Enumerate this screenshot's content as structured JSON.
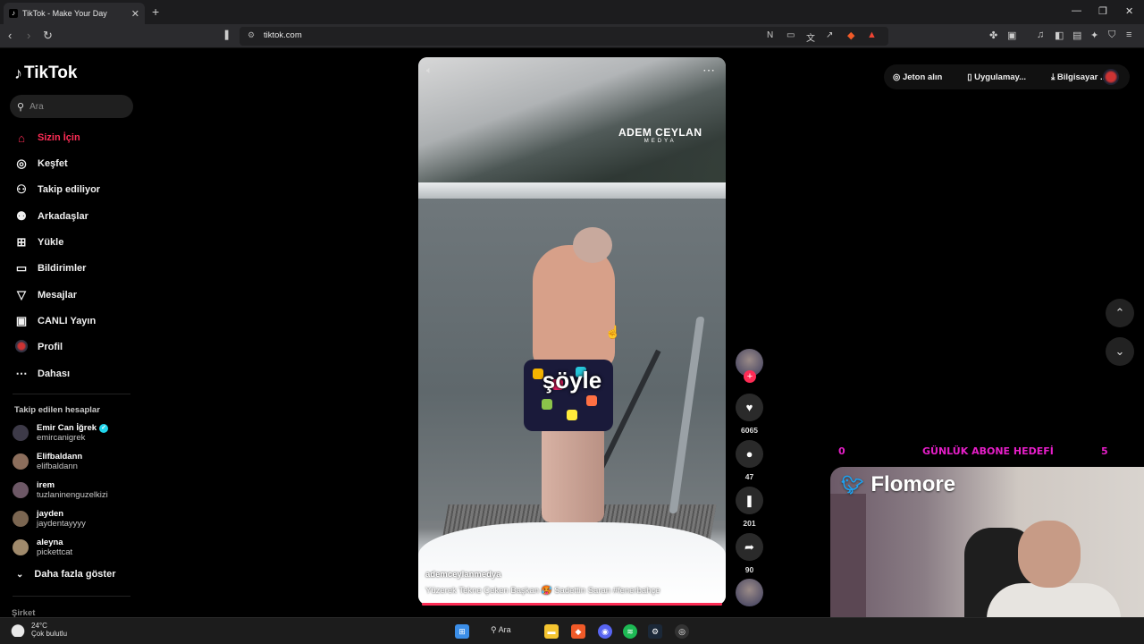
{
  "browser": {
    "tab_title": "TikTok - Make Your Day",
    "url": "tiktok.com"
  },
  "sidebar": {
    "logo": "TikTok",
    "search_placeholder": "Ara",
    "nav": [
      {
        "label": "Sizin İçin",
        "icon": "home-icon",
        "active": true
      },
      {
        "label": "Keşfet",
        "icon": "compass-icon"
      },
      {
        "label": "Takip ediliyor",
        "icon": "following-icon"
      },
      {
        "label": "Arkadaşlar",
        "icon": "friends-icon"
      },
      {
        "label": "Yükle",
        "icon": "upload-icon"
      },
      {
        "label": "Bildirimler",
        "icon": "notifications-icon"
      },
      {
        "label": "Mesajlar",
        "icon": "messages-icon"
      },
      {
        "label": "CANLI Yayın",
        "icon": "live-icon"
      },
      {
        "label": "Profil",
        "icon": "profile-avatar"
      },
      {
        "label": "Dahası",
        "icon": "more-icon"
      }
    ],
    "following_header": "Takip edilen hesaplar",
    "following": [
      {
        "name": "Emir Can İğrek",
        "handle": "emircanigrek",
        "verified": true
      },
      {
        "name": "Elifbaldann",
        "handle": "elifbaldann"
      },
      {
        "name": "irem",
        "handle": "tuzlaninenguzelkizi"
      },
      {
        "name": "jayden",
        "handle": "jaydentayyyy"
      },
      {
        "name": "aleyna",
        "handle": "pickettcat"
      }
    ],
    "show_more": "Daha fazla göster",
    "footer": "Şirket"
  },
  "video": {
    "watermark": "ADEM CEYLAN",
    "watermark_sub": "MEDYA",
    "caption": "şöyle",
    "author": "ademceylanmedya",
    "description": "Yüzerek Tekne Çeken Başkan 🥵 Sadettin Saran #fenerbahçe",
    "progress": 1.0
  },
  "actions": {
    "likes": "6065",
    "comments": "47",
    "saves": "201",
    "shares": "90"
  },
  "topbar": {
    "coins": "Jeton alın",
    "app": "Uygulamay...",
    "desktop": "Bilgisayar ..."
  },
  "overlay": {
    "goal_current": "0",
    "goal_label": "GÜNLÜK ABONE HEDEFİ",
    "goal_target": "5",
    "streamer": "Flomore"
  },
  "taskbar": {
    "temp": "24°C",
    "weather": "Çok bulutlu",
    "search": "Ara"
  }
}
